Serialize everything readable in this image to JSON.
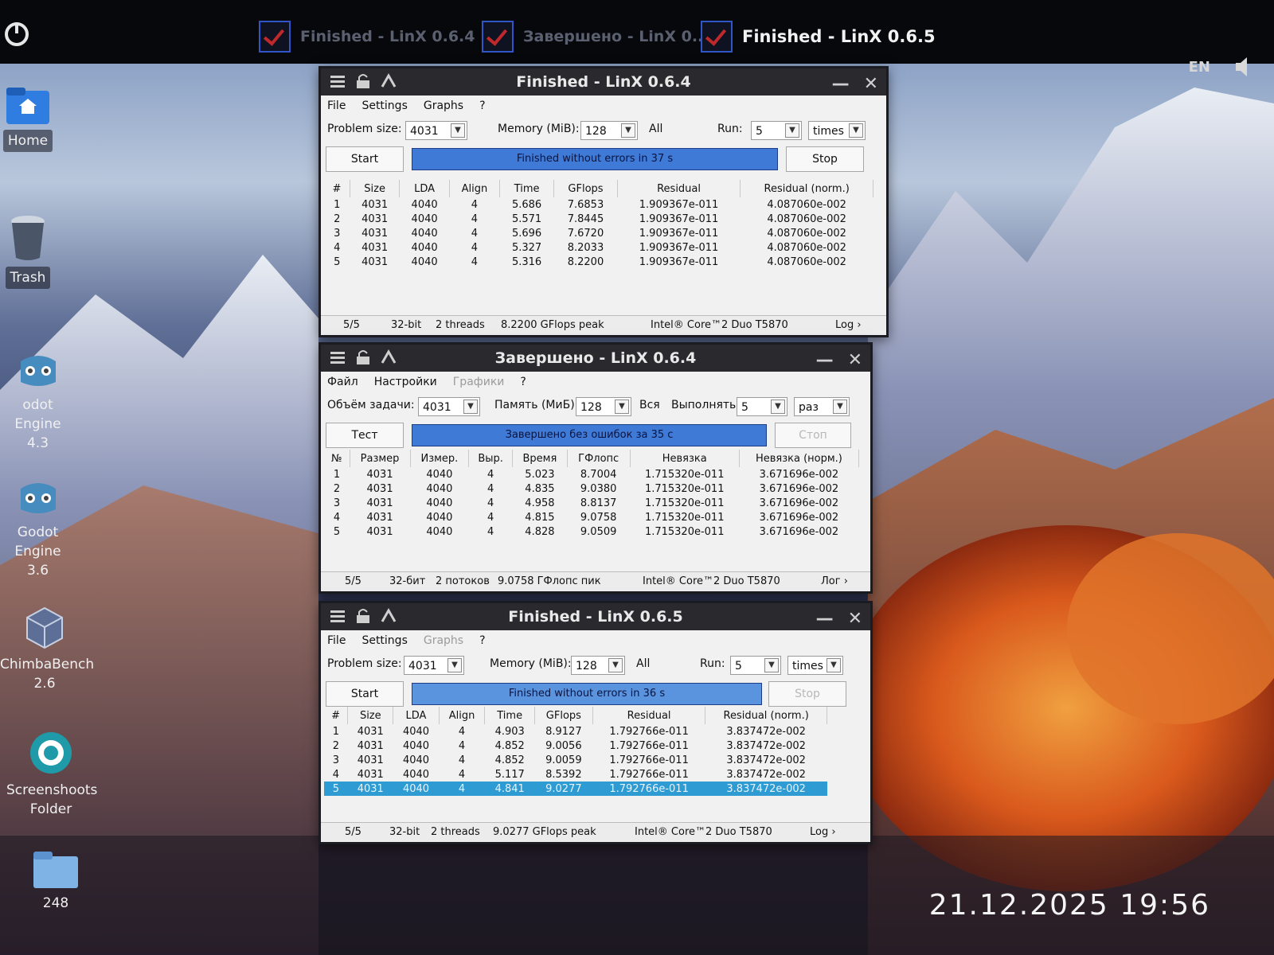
{
  "taskbar": {
    "tasks": [
      {
        "label": "Finished - LinX 0.6.4"
      },
      {
        "label": "Завершено - LinX 0..."
      },
      {
        "label": "Finished - LinX 0.6.5"
      }
    ],
    "language": "EN"
  },
  "desktop_icons": [
    {
      "label": "Home"
    },
    {
      "label": "Trash"
    },
    {
      "label": "odot Engine",
      "sub": "4.3"
    },
    {
      "label": "Godot Engine",
      "sub": "3.6"
    },
    {
      "label": "ChimbaBench",
      "sub": "2.6"
    },
    {
      "label": "Screenshoots",
      "sub": "Folder"
    },
    {
      "label": "248"
    }
  ],
  "clock": "21.12.2025 19:56",
  "windows": [
    {
      "title": "Finished - LinX 0.6.4",
      "menu": [
        "File",
        "Settings",
        "Graphs",
        "?"
      ],
      "problem_size_label": "Problem size:",
      "problem_size": "4031",
      "memory_label": "Memory (MiB):",
      "memory": "128",
      "all_label": "All",
      "run_label": "Run:",
      "run": "5",
      "run_unit": "times",
      "start_label": "Start",
      "progress_text": "Finished without errors in 37 s",
      "stop_label": "Stop",
      "columns": [
        "#",
        "Size",
        "LDA",
        "Align",
        "Time",
        "GFlops",
        "Residual",
        "Residual (norm.)"
      ],
      "rows": [
        [
          "1",
          "4031",
          "4040",
          "4",
          "5.686",
          "7.6853",
          "1.909367e-011",
          "4.087060e-002"
        ],
        [
          "2",
          "4031",
          "4040",
          "4",
          "5.571",
          "7.8445",
          "1.909367e-011",
          "4.087060e-002"
        ],
        [
          "3",
          "4031",
          "4040",
          "4",
          "5.696",
          "7.6720",
          "1.909367e-011",
          "4.087060e-002"
        ],
        [
          "4",
          "4031",
          "4040",
          "4",
          "5.327",
          "8.2033",
          "1.909367e-011",
          "4.087060e-002"
        ],
        [
          "5",
          "4031",
          "4040",
          "4",
          "5.316",
          "8.2200",
          "1.909367e-011",
          "4.087060e-002"
        ]
      ],
      "status": {
        "count": "5/5",
        "bits": "32-bit",
        "threads": "2 threads",
        "peak": "8.2200 GFlops peak",
        "cpu": "Intel® Core™2 Duo T5870",
        "log": "Log ›"
      }
    },
    {
      "title": "Завершено - LinX 0.6.4",
      "menu": [
        "Файл",
        "Настройки",
        "Графики",
        "?"
      ],
      "problem_size_label": "Объём задачи:",
      "problem_size": "4031",
      "memory_label": "Память (МиБ):",
      "memory": "128",
      "all_label": "Вся",
      "run_label": "Выполнять:",
      "run": "5",
      "run_unit": "раз",
      "start_label": "Тест",
      "progress_text": "Завершено без ошибок за 35 с",
      "stop_label": "Стоп",
      "columns": [
        "№",
        "Размер",
        "Измер.",
        "Выр.",
        "Время",
        "ГФлопс",
        "Невязка",
        "Невязка (норм.)"
      ],
      "rows": [
        [
          "1",
          "4031",
          "4040",
          "4",
          "5.023",
          "8.7004",
          "1.715320e-011",
          "3.671696e-002"
        ],
        [
          "2",
          "4031",
          "4040",
          "4",
          "4.835",
          "9.0380",
          "1.715320e-011",
          "3.671696e-002"
        ],
        [
          "3",
          "4031",
          "4040",
          "4",
          "4.958",
          "8.8137",
          "1.715320e-011",
          "3.671696e-002"
        ],
        [
          "4",
          "4031",
          "4040",
          "4",
          "4.815",
          "9.0758",
          "1.715320e-011",
          "3.671696e-002"
        ],
        [
          "5",
          "4031",
          "4040",
          "4",
          "4.828",
          "9.0509",
          "1.715320e-011",
          "3.671696e-002"
        ]
      ],
      "status": {
        "count": "5/5",
        "bits": "32-бит",
        "threads": "2 потоков",
        "peak": "9.0758 ГФлопс пик",
        "cpu": "Intel® Core™2 Duo T5870",
        "log": "Лог ›"
      }
    },
    {
      "title": "Finished - LinX 0.6.5",
      "menu": [
        "File",
        "Settings",
        "Graphs",
        "?"
      ],
      "problem_size_label": "Problem size:",
      "problem_size": "4031",
      "memory_label": "Memory (MiB):",
      "memory": "128",
      "all_label": "All",
      "run_label": "Run:",
      "run": "5",
      "run_unit": "times",
      "start_label": "Start",
      "progress_text": "Finished without errors in 36 s",
      "stop_label": "Stop",
      "columns": [
        "#",
        "Size",
        "LDA",
        "Align",
        "Time",
        "GFlops",
        "Residual",
        "Residual (norm.)"
      ],
      "rows": [
        [
          "1",
          "4031",
          "4040",
          "4",
          "4.903",
          "8.9127",
          "1.792766e-011",
          "3.837472e-002"
        ],
        [
          "2",
          "4031",
          "4040",
          "4",
          "4.852",
          "9.0056",
          "1.792766e-011",
          "3.837472e-002"
        ],
        [
          "3",
          "4031",
          "4040",
          "4",
          "4.852",
          "9.0059",
          "1.792766e-011",
          "3.837472e-002"
        ],
        [
          "4",
          "4031",
          "4040",
          "4",
          "5.117",
          "8.5392",
          "1.792766e-011",
          "3.837472e-002"
        ],
        [
          "5",
          "4031",
          "4040",
          "4",
          "4.841",
          "9.0277",
          "1.792766e-011",
          "3.837472e-002"
        ]
      ],
      "selected_row": 4,
      "status": {
        "count": "5/5",
        "bits": "32-bit",
        "threads": "2 threads",
        "peak": "9.0277 GFlops peak",
        "cpu": "Intel® Core™2 Duo T5870",
        "log": "Log ›"
      }
    }
  ],
  "colors": {
    "progress": "#3f7ad6",
    "selection": "#2f9bd3",
    "titlebar": "#2a2a2e",
    "task_check": "#c0292b"
  }
}
